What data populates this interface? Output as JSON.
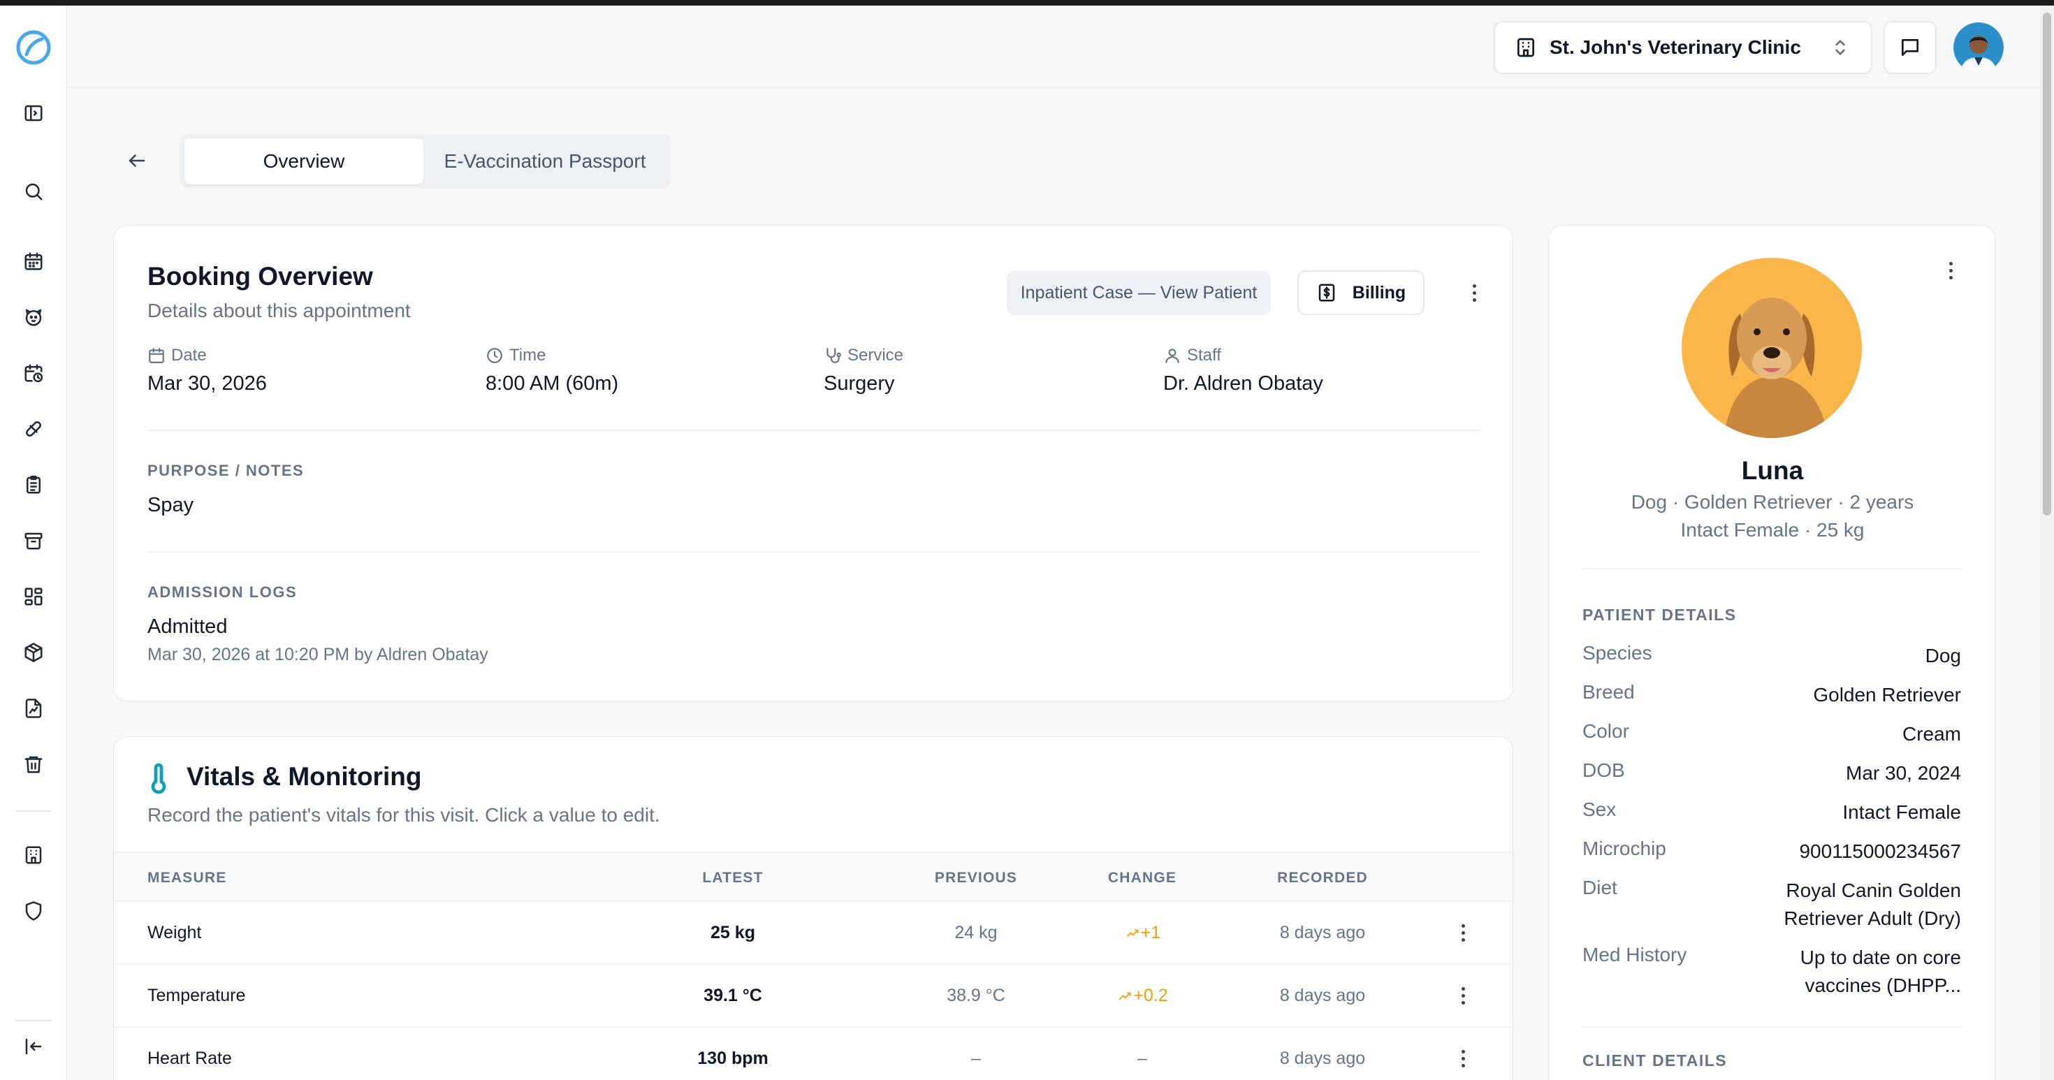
{
  "header": {
    "clinic_name": "St. John's Veterinary Clinic"
  },
  "tabs": [
    {
      "label": "Overview",
      "active": true
    },
    {
      "label": "E-Vaccination Passport",
      "active": false
    }
  ],
  "booking": {
    "title": "Booking Overview",
    "subtitle": "Details about this appointment",
    "inpatient_label": "Inpatient Case — View Patient",
    "billing_label": "Billing",
    "info": [
      {
        "icon": "calendar-icon",
        "label": "Date",
        "value": "Mar 30, 2026"
      },
      {
        "icon": "clock-icon",
        "label": "Time",
        "value": "8:00 AM (60m)"
      },
      {
        "icon": "stethoscope-icon",
        "label": "Service",
        "value": "Surgery"
      },
      {
        "icon": "user-icon",
        "label": "Staff",
        "value": "Dr. Aldren Obatay"
      }
    ],
    "notes_label": "PURPOSE / NOTES",
    "notes_value": "Spay",
    "admission_label": "ADMISSION LOGS",
    "admission_value": "Admitted",
    "admission_meta": "Mar 30, 2026 at 10:20 PM by Aldren Obatay"
  },
  "vitals": {
    "title": "Vitals & Monitoring",
    "subtitle": "Record the patient's vitals for this visit. Click a value to edit.",
    "columns": [
      "MEASURE",
      "LATEST",
      "PREVIOUS",
      "CHANGE",
      "RECORDED"
    ],
    "rows": [
      {
        "measure": "Weight",
        "latest": "25 kg",
        "previous": "24 kg",
        "change": "+1",
        "recorded": "8 days ago",
        "trend": "up"
      },
      {
        "measure": "Temperature",
        "latest": "39.1 °C",
        "previous": "38.9 °C",
        "change": "+0.2",
        "recorded": "8 days ago",
        "trend": "up"
      },
      {
        "measure": "Heart Rate",
        "latest": "130 bpm",
        "previous": "–",
        "change": "–",
        "recorded": "8 days ago",
        "trend": "none"
      }
    ]
  },
  "patient": {
    "name": "Luna",
    "line1": "Dog · Golden Retriever · 2 years",
    "line2": "Intact Female · 25 kg",
    "details_label": "PATIENT DETAILS",
    "details": [
      {
        "key": "Species",
        "value": "Dog"
      },
      {
        "key": "Breed",
        "value": "Golden Retriever"
      },
      {
        "key": "Color",
        "value": "Cream"
      },
      {
        "key": "DOB",
        "value": "Mar 30, 2024"
      },
      {
        "key": "Sex",
        "value": "Intact Female"
      },
      {
        "key": "Microchip",
        "value": "900115000234567"
      },
      {
        "key": "Diet",
        "value": "Royal Canin Golden Retriever Adult (Dry)"
      },
      {
        "key": "Med History",
        "value": "Up to date on core vaccines (DHPP..."
      }
    ],
    "client_label": "CLIENT DETAILS"
  },
  "colors": {
    "accent_teal": "#0e9fb4",
    "trend_orange": "#f59e0b",
    "pet_bg": "#fbb64a"
  }
}
